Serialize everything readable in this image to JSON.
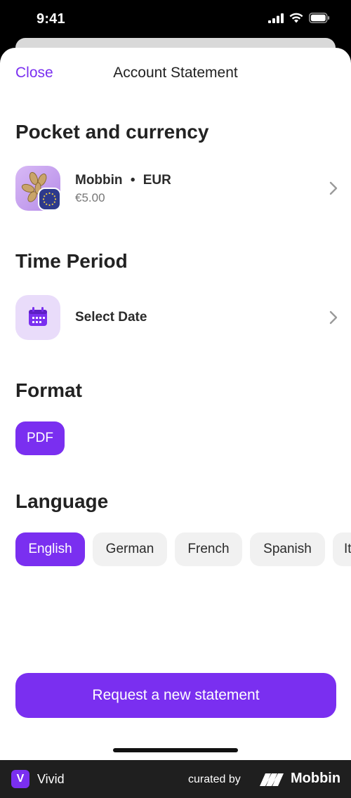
{
  "status_bar": {
    "time": "9:41"
  },
  "header": {
    "close_label": "Close",
    "title": "Account Statement"
  },
  "pocket_section": {
    "title": "Pocket and currency",
    "pocket_name": "Mobbin",
    "separator": "•",
    "currency": "EUR",
    "balance": "€5.00"
  },
  "time_section": {
    "title": "Time Period",
    "select_label": "Select Date"
  },
  "format_section": {
    "title": "Format",
    "options": [
      "PDF"
    ],
    "selected": "PDF"
  },
  "language_section": {
    "title": "Language",
    "options": [
      "English",
      "German",
      "French",
      "Spanish",
      "It"
    ],
    "selected": "English"
  },
  "cta": {
    "label": "Request a new statement"
  },
  "footer": {
    "app_initial": "V",
    "app_name": "Vivid",
    "curated_by": "curated by",
    "brand": "Mobbin"
  },
  "colors": {
    "accent": "#7a2ff0",
    "chip_inactive": "#f1f1f1",
    "icon_bg": "#e9dcfa"
  },
  "icons": [
    "signal-icon",
    "wifi-icon",
    "battery-icon",
    "chevron-right-icon",
    "calendar-icon",
    "eu-flag-icon"
  ]
}
